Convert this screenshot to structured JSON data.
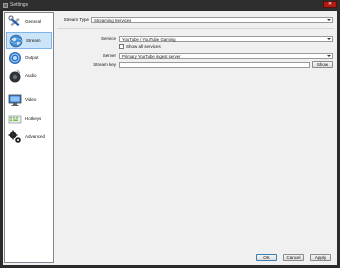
{
  "window": {
    "title": "Settings",
    "close_label": "✕"
  },
  "sidebar": {
    "items": [
      {
        "label": "General",
        "icon": "wrench-screwdriver-icon",
        "selected": false
      },
      {
        "label": "Stream",
        "icon": "globe-icon",
        "selected": true
      },
      {
        "label": "Output",
        "icon": "output-signal-icon",
        "selected": false
      },
      {
        "label": "Audio",
        "icon": "speaker-icon",
        "selected": false
      },
      {
        "label": "Video",
        "icon": "monitor-icon",
        "selected": false
      },
      {
        "label": "Hotkeys",
        "icon": "keyboard-icon",
        "selected": false
      },
      {
        "label": "Advanced",
        "icon": "gears-icon",
        "selected": false
      }
    ]
  },
  "stream": {
    "stream_type_label": "Stream Type",
    "stream_type_value": "Streaming Services",
    "service_label": "Service",
    "service_value": "YouTube / YouTube Gaming",
    "show_all_label": "Show all services",
    "show_all_checked": false,
    "server_label": "Server",
    "server_value": "Primary YouTube ingest server",
    "stream_key_label": "Stream key",
    "stream_key_value": "",
    "show_button": "Show"
  },
  "footer": {
    "ok": "OK",
    "cancel": "Cancel",
    "apply": "Apply"
  },
  "colors": {
    "selected_bg": "#cce4f7",
    "selected_border": "#7eb4ea",
    "close_red": "#b01a13"
  }
}
